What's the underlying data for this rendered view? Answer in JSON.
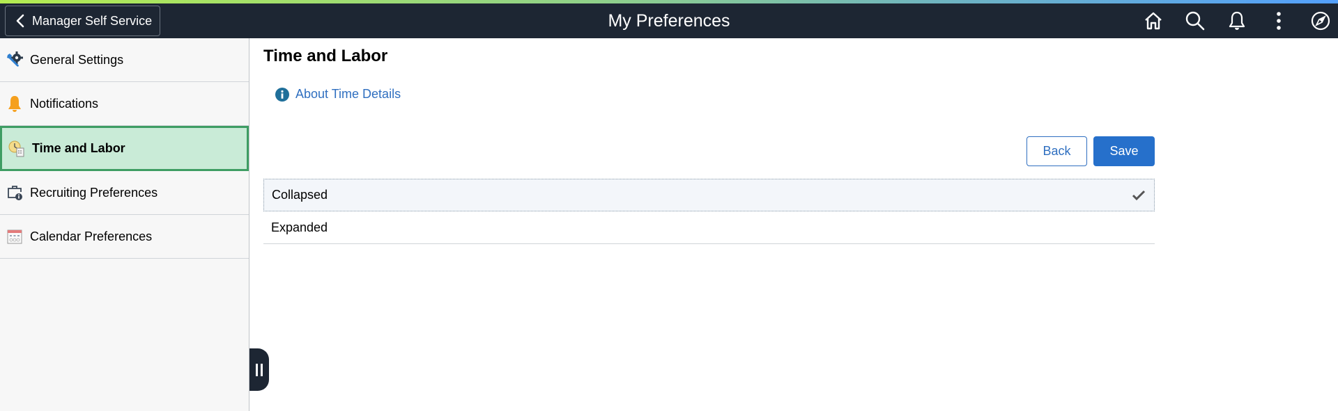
{
  "header": {
    "back_label": "Manager Self Service",
    "title": "My Preferences",
    "icons": [
      "home-icon",
      "search-icon",
      "bell-icon",
      "more-vertical-icon",
      "compass-icon"
    ]
  },
  "colors": {
    "header_bg": "#1d2633",
    "accent_blue": "#2670cb",
    "active_nav_bg": "#c9ebd7",
    "active_nav_border": "#3e9d63",
    "gradient_start": "#b4ec51",
    "gradient_end": "#53a0fd"
  },
  "sidebar": {
    "items": [
      {
        "label": "General Settings",
        "icon": "wrench-gear-icon",
        "active": false
      },
      {
        "label": "Notifications",
        "icon": "bell-icon",
        "active": false
      },
      {
        "label": "Time and Labor",
        "icon": "clock-document-icon",
        "active": true
      },
      {
        "label": "Recruiting Preferences",
        "icon": "briefcase-info-icon",
        "active": false
      },
      {
        "label": "Calendar Preferences",
        "icon": "calendar-icon",
        "active": false
      }
    ]
  },
  "main": {
    "title": "Time and Labor",
    "about_link": "About Time Details",
    "back_button": "Back",
    "save_button": "Save",
    "options": [
      {
        "label": "Collapsed",
        "selected": true
      },
      {
        "label": "Expanded",
        "selected": false
      }
    ]
  }
}
